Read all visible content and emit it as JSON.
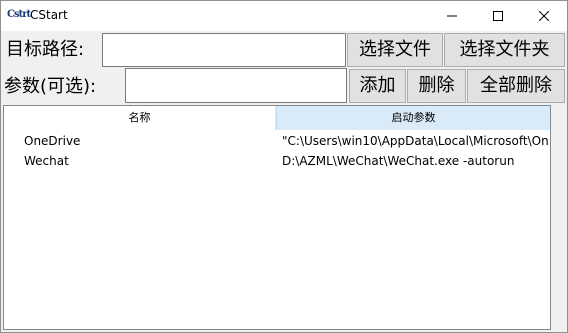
{
  "window": {
    "title": "CStart",
    "icon_text": "Cstrt"
  },
  "title_buttons": {
    "minimize": "minimize-icon",
    "maximize": "maximize-icon",
    "close": "close-icon"
  },
  "row1": {
    "label": "目标路径:",
    "input_value": "",
    "btn_select_file": "选择文件",
    "btn_select_folder": "选择文件夹"
  },
  "row2": {
    "label": "参数(可选):",
    "input_value": "",
    "btn_add": "添加",
    "btn_delete": "删除",
    "btn_delete_all": "全部删除"
  },
  "table": {
    "columns": [
      "名称",
      "启动参数"
    ],
    "rows": [
      {
        "name": "OneDrive",
        "args": "\"C:\\Users\\win10\\AppData\\Local\\Microsoft\\On"
      },
      {
        "name": "Wechat",
        "args": "D:\\AZML\\WeChat\\WeChat.exe -autorun"
      }
    ]
  }
}
